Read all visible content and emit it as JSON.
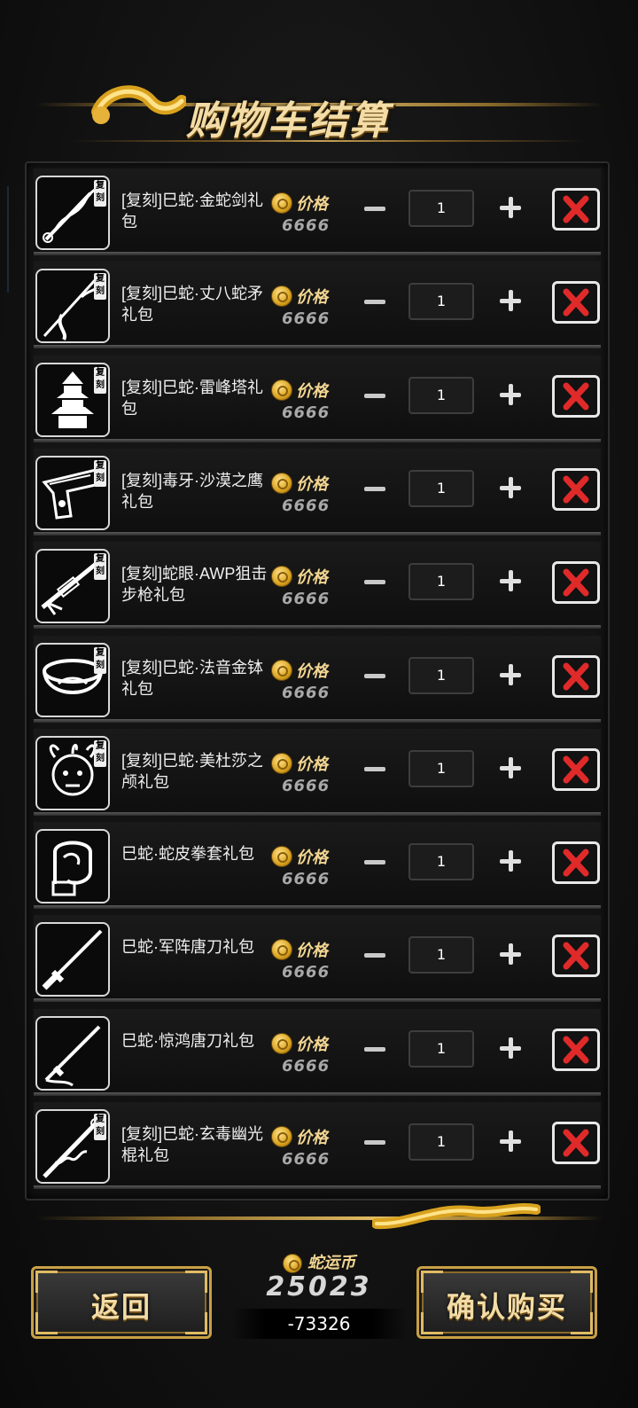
{
  "header": {
    "title": "购物车结算"
  },
  "price_label": "价格",
  "items": [
    {
      "name": "[复刻]巳蛇·金蛇剑礼包",
      "tag": "复刻",
      "price": "6666",
      "qty": "1",
      "icon": "snake-sword-icon"
    },
    {
      "name": "[复刻]巳蛇·丈八蛇矛礼包",
      "tag": "复刻",
      "price": "6666",
      "qty": "1",
      "icon": "snake-spear-icon"
    },
    {
      "name": "[复刻]巳蛇·雷峰塔礼包",
      "tag": "复刻",
      "price": "6666",
      "qty": "1",
      "icon": "pagoda-icon"
    },
    {
      "name": "[复刻]毒牙·沙漠之鹰礼包",
      "tag": "复刻",
      "price": "6666",
      "qty": "1",
      "icon": "desert-eagle-icon"
    },
    {
      "name": "[复刻]蛇眼·AWP狙击步枪礼包",
      "tag": "复刻",
      "price": "6666",
      "qty": "1",
      "icon": "sniper-rifle-icon"
    },
    {
      "name": "[复刻]巳蛇·法音金钵礼包",
      "tag": "复刻",
      "price": "6666",
      "qty": "1",
      "icon": "golden-bowl-icon"
    },
    {
      "name": "[复刻]巳蛇·美杜莎之颅礼包",
      "tag": "复刻",
      "price": "6666",
      "qty": "1",
      "icon": "medusa-head-icon"
    },
    {
      "name": "巳蛇·蛇皮拳套礼包",
      "tag": "",
      "price": "6666",
      "qty": "1",
      "icon": "boxing-glove-icon"
    },
    {
      "name": "巳蛇·军阵唐刀礼包",
      "tag": "",
      "price": "6666",
      "qty": "1",
      "icon": "tang-sword-icon"
    },
    {
      "name": "巳蛇·惊鸿唐刀礼包",
      "tag": "",
      "price": "6666",
      "qty": "1",
      "icon": "tang-blade-icon"
    },
    {
      "name": "[复刻]巳蛇·玄毒幽光棍礼包",
      "tag": "复刻",
      "price": "6666",
      "qty": "1",
      "icon": "staff-icon"
    }
  ],
  "wallet": {
    "label": "蛇运币",
    "balance": "25023",
    "diff": "-73326"
  },
  "buttons": {
    "back": "返回",
    "confirm": "确认购买"
  },
  "colors": {
    "gold": "#f3dca6",
    "accent": "#c9a045",
    "delete": "#e02a2a"
  }
}
